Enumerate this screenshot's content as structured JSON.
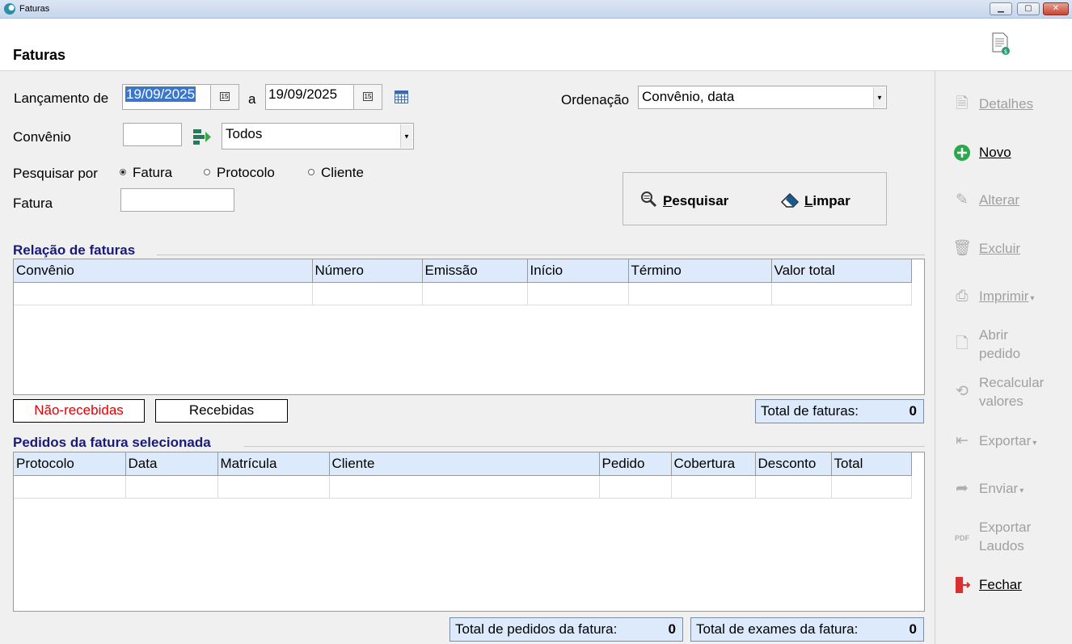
{
  "window": {
    "title": "Faturas",
    "minimize": "▁",
    "maximize": "▢",
    "close": "✕"
  },
  "header": {
    "title": "Faturas"
  },
  "filters": {
    "lancamento_label": "Lançamento de",
    "date_from": "19/09/2025",
    "date_sep": "a",
    "date_to": "19/09/2025",
    "calendar_btn": "15",
    "ordenacao_label": "Ordenação",
    "ordenacao_value": "Convênio, data",
    "convenio_label": "Convênio",
    "convenio_code": "",
    "convenio_value": "Todos",
    "pesquisar_por_label": "Pesquisar por",
    "radio_options": [
      "Fatura",
      "Protocolo",
      "Cliente"
    ],
    "fatura_label": "Fatura",
    "fatura_value": ""
  },
  "actions": {
    "search": {
      "accel": "P",
      "rest": "esquisar"
    },
    "clear": {
      "accel": "L",
      "rest": "impar"
    }
  },
  "invoices": {
    "title": "Relação de faturas",
    "columns": [
      "Convênio",
      "Número",
      "Emissão",
      "Início",
      "Término",
      "Valor total"
    ],
    "tab_unreceived": "Não-recebidas",
    "tab_received": "Recebidas",
    "total_label": "Total de faturas:",
    "total_value": "0"
  },
  "orders": {
    "title": "Pedidos da fatura selecionada",
    "columns": [
      "Protocolo",
      "Data",
      "Matrícula",
      "Cliente",
      "Pedido",
      "Cobertura",
      "Desconto",
      "Total"
    ],
    "total_orders_label": "Total de pedidos da fatura:",
    "total_orders_value": "0",
    "total_exams_label": "Total de exames da fatura:",
    "total_exams_value": "0"
  },
  "sidebar": {
    "detalhes": "Detalhes",
    "novo": "Novo",
    "alterar": "Alterar",
    "excluir": "Excluir",
    "imprimir": "Imprimir",
    "abrir_1": "Abrir",
    "abrir_2": "pedido",
    "recalc_1": "Recalcular",
    "recalc_2": "valores",
    "exportar": "Exportar",
    "enviar": "Enviar",
    "explaudos_1": "Exportar",
    "explaudos_2": "Laudos",
    "fechar": "Fechar"
  },
  "colors": {
    "accent_section": "#1a1a7a",
    "unreceived_text": "#e00000",
    "grid_header": "#ddeafb",
    "disabled": "#a0a0a0"
  }
}
